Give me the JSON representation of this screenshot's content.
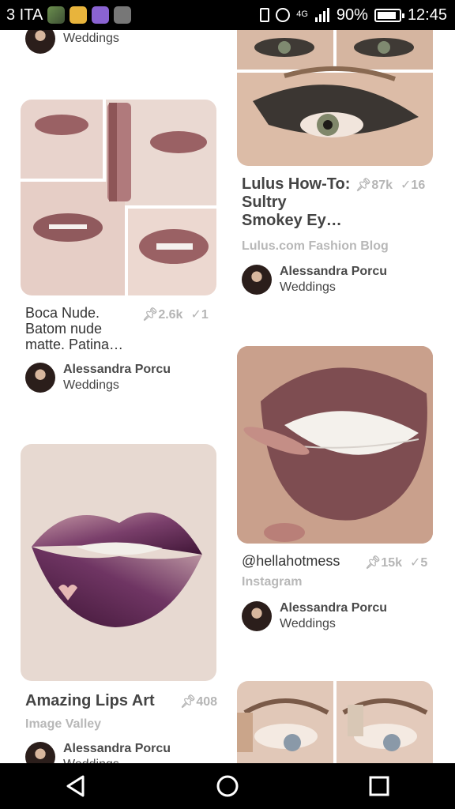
{
  "status_bar": {
    "carrier": "3 ITA",
    "network": "4G",
    "battery_percent": "90%",
    "battery_level": 0.9,
    "time": "12:45"
  },
  "pins": [
    {
      "title": "",
      "pin_count": "",
      "save_count": "",
      "source": "",
      "user": "",
      "board": "Weddings"
    },
    {
      "title": "Boca Nude. Batom nude matte. Patina…",
      "pin_count": "2.6k",
      "save_count": "1",
      "source": "",
      "user": "Alessandra Porcu",
      "board": "Weddings"
    },
    {
      "title": "Amazing Lips Art",
      "pin_count": "408",
      "save_count": "",
      "source": "Image Valley",
      "user": "Alessandra Porcu",
      "board": "Weddings"
    },
    {
      "title": "Lulus How-To: Sultry Smokey Ey…",
      "pin_count": "87k",
      "save_count": "16",
      "source": "Lulus.com Fashion Blog",
      "user": "Alessandra Porcu",
      "board": "Weddings"
    },
    {
      "title": "@hellahotmess",
      "pin_count": "15k",
      "save_count": "5",
      "source": "Instagram",
      "user": "Alessandra Porcu",
      "board": "Weddings"
    }
  ],
  "icons": {
    "pin": "pushpin-icon",
    "save": "check-icon",
    "back": "back-triangle-icon",
    "home": "home-circle-icon",
    "recents": "recents-square-icon"
  },
  "colors": {
    "status_bar": "#000000",
    "nav_bar": "#000000",
    "meta_text": "#b5b5b5",
    "lip_mauve": "#8c5a5c",
    "lip_purple": "#4a1c40"
  }
}
